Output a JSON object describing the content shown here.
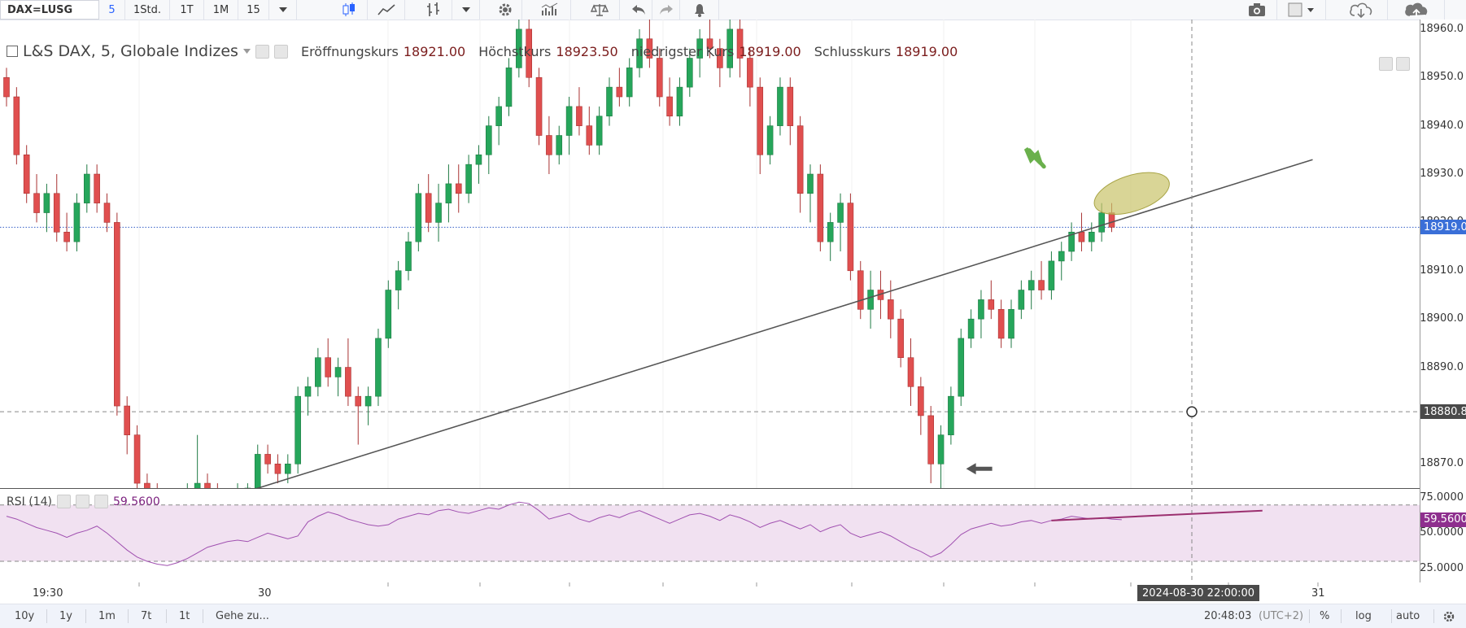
{
  "toolbar": {
    "symbol": "DAX=LUSG",
    "intervals": [
      "5",
      "1Std.",
      "1T",
      "1M",
      "15"
    ],
    "active_interval": "5"
  },
  "legend": {
    "title": "L&S DAX, 5, Globale Indizes",
    "open_label": "Eröffnungskurs",
    "open_value": "18921.00",
    "high_label": "Höchstkurs",
    "high_value": "18923.50",
    "low_label": "niedrigster Kurs",
    "low_value": "18919.00",
    "close_label": "Schlusskurs",
    "close_value": "18919.00"
  },
  "price_axis": {
    "labels": [
      "18960.0",
      "18950.0",
      "18940.0",
      "18930.0",
      "18920.0",
      "18910.0",
      "18900.0",
      "18890.0",
      "18880.0",
      "18870.0"
    ],
    "last_price_badge": "18919.0",
    "crosshair_badge": "18880.8"
  },
  "rsi": {
    "label": "RSI (14)",
    "value": "59.5600",
    "axis_labels": [
      "75.0000",
      "50.0000",
      "25.0000"
    ],
    "badge": "59.5600"
  },
  "time_axis": {
    "labels": [
      "19:30",
      "30",
      "31"
    ],
    "crosshair_label": "2024-08-30 22:00:00"
  },
  "bottombar": {
    "ranges": [
      "10y",
      "1y",
      "1m",
      "7t",
      "1t"
    ],
    "goto": "Gehe zu...",
    "clock": "20:48:03",
    "timezone": "(UTC+2)",
    "percent": "%",
    "log": "log",
    "auto": "auto"
  },
  "colors": {
    "up": "#26a65b",
    "down": "#e04f4f",
    "trendline": "#555555",
    "rsi_line": "#a050b0",
    "rsi_band": "#f1e1f1",
    "highlight": "#c9c36a",
    "arrow_green": "#6ab04c"
  },
  "chart_data": [
    {
      "type": "candlestick",
      "title": "L&S DAX, 5, Globale Indizes",
      "ylim": [
        18865,
        18962
      ],
      "last_price": 18919.0,
      "crosshair_price": 18880.8,
      "candles": [
        [
          18950,
          18952,
          18944,
          18946
        ],
        [
          18946,
          18948,
          18932,
          18934
        ],
        [
          18934,
          18936,
          18924,
          18926
        ],
        [
          18926,
          18930,
          18920,
          18922
        ],
        [
          18922,
          18928,
          18918,
          18926
        ],
        [
          18926,
          18930,
          18916,
          18918
        ],
        [
          18918,
          18922,
          18914,
          18916
        ],
        [
          18916,
          18926,
          18914,
          18924
        ],
        [
          18924,
          18932,
          18922,
          18930
        ],
        [
          18930,
          18932,
          18922,
          18924
        ],
        [
          18924,
          18926,
          18918,
          18920
        ],
        [
          18920,
          18922,
          18880,
          18882
        ],
        [
          18882,
          18884,
          18872,
          18876
        ],
        [
          18876,
          18878,
          18864,
          18866
        ],
        [
          18866,
          18868,
          18862,
          18864
        ],
        [
          18864,
          18866,
          18860,
          18862
        ],
        [
          18862,
          18864,
          18858,
          18860
        ],
        [
          18860,
          18864,
          18856,
          18862
        ],
        [
          18862,
          18866,
          18858,
          18864
        ],
        [
          18864,
          18876,
          18862,
          18866
        ],
        [
          18866,
          18868,
          18862,
          18864
        ],
        [
          18864,
          18866,
          18860,
          18862
        ],
        [
          18862,
          18864,
          18860,
          18863
        ],
        [
          18863,
          18866,
          18861,
          18864
        ],
        [
          18864,
          18866,
          18862,
          18865
        ],
        [
          18865,
          18874,
          18864,
          18872
        ],
        [
          18872,
          18874,
          18868,
          18870
        ],
        [
          18870,
          18872,
          18866,
          18868
        ],
        [
          18868,
          18872,
          18866,
          18870
        ],
        [
          18870,
          18886,
          18868,
          18884
        ],
        [
          18884,
          18888,
          18880,
          18886
        ],
        [
          18886,
          18894,
          18884,
          18892
        ],
        [
          18892,
          18896,
          18886,
          18888
        ],
        [
          18888,
          18892,
          18884,
          18890
        ],
        [
          18890,
          18896,
          18882,
          18884
        ],
        [
          18884,
          18886,
          18874,
          18882
        ],
        [
          18882,
          18886,
          18878,
          18884
        ],
        [
          18884,
          18898,
          18882,
          18896
        ],
        [
          18896,
          18908,
          18894,
          18906
        ],
        [
          18906,
          18912,
          18902,
          18910
        ],
        [
          18910,
          18918,
          18908,
          18916
        ],
        [
          18916,
          18928,
          18914,
          18926
        ],
        [
          18926,
          18930,
          18918,
          18920
        ],
        [
          18920,
          18928,
          18916,
          18924
        ],
        [
          18924,
          18932,
          18920,
          18928
        ],
        [
          18928,
          18932,
          18922,
          18926
        ],
        [
          18926,
          18934,
          18924,
          18932
        ],
        [
          18932,
          18936,
          18928,
          18934
        ],
        [
          18934,
          18942,
          18930,
          18940
        ],
        [
          18940,
          18946,
          18936,
          18944
        ],
        [
          18944,
          18954,
          18942,
          18952
        ],
        [
          18952,
          18962,
          18950,
          18960
        ],
        [
          18960,
          18962,
          18948,
          18950
        ],
        [
          18950,
          18952,
          18936,
          18938
        ],
        [
          18938,
          18942,
          18930,
          18934
        ],
        [
          18934,
          18940,
          18932,
          18938
        ],
        [
          18938,
          18946,
          18934,
          18944
        ],
        [
          18944,
          18948,
          18938,
          18940
        ],
        [
          18940,
          18944,
          18934,
          18936
        ],
        [
          18936,
          18944,
          18934,
          18942
        ],
        [
          18942,
          18950,
          18940,
          18948
        ],
        [
          18948,
          18952,
          18944,
          18946
        ],
        [
          18946,
          18954,
          18944,
          18952
        ],
        [
          18952,
          18960,
          18950,
          18958
        ],
        [
          18958,
          18962,
          18952,
          18954
        ],
        [
          18954,
          18956,
          18944,
          18946
        ],
        [
          18946,
          18950,
          18940,
          18942
        ],
        [
          18942,
          18950,
          18940,
          18948
        ],
        [
          18948,
          18956,
          18946,
          18954
        ],
        [
          18954,
          18960,
          18950,
          18958
        ],
        [
          18958,
          18962,
          18954,
          18956
        ],
        [
          18956,
          18958,
          18948,
          18952
        ],
        [
          18952,
          18962,
          18950,
          18960
        ],
        [
          18960,
          18962,
          18950,
          18954
        ],
        [
          18954,
          18956,
          18944,
          18948
        ],
        [
          18948,
          18950,
          18930,
          18934
        ],
        [
          18934,
          18942,
          18932,
          18940
        ],
        [
          18940,
          18950,
          18938,
          18948
        ],
        [
          18948,
          18950,
          18936,
          18940
        ],
        [
          18940,
          18942,
          18922,
          18926
        ],
        [
          18926,
          18932,
          18920,
          18930
        ],
        [
          18930,
          18932,
          18914,
          18916
        ],
        [
          18916,
          18922,
          18912,
          18920
        ],
        [
          18920,
          18926,
          18914,
          18924
        ],
        [
          18924,
          18926,
          18908,
          18910
        ],
        [
          18910,
          18912,
          18900,
          18902
        ],
        [
          18902,
          18910,
          18898,
          18906
        ],
        [
          18906,
          18910,
          18900,
          18904
        ],
        [
          18904,
          18908,
          18896,
          18900
        ],
        [
          18900,
          18902,
          18890,
          18892
        ],
        [
          18892,
          18896,
          18882,
          18886
        ],
        [
          18886,
          18888,
          18876,
          18880
        ],
        [
          18880,
          18882,
          18866,
          18870
        ],
        [
          18870,
          18878,
          18864,
          18876
        ],
        [
          18876,
          18886,
          18874,
          18884
        ],
        [
          18884,
          18898,
          18882,
          18896
        ],
        [
          18896,
          18902,
          18894,
          18900
        ],
        [
          18900,
          18906,
          18896,
          18904
        ],
        [
          18904,
          18908,
          18900,
          18902
        ],
        [
          18902,
          18904,
          18894,
          18896
        ],
        [
          18896,
          18904,
          18894,
          18902
        ],
        [
          18902,
          18908,
          18900,
          18906
        ],
        [
          18906,
          18910,
          18902,
          18908
        ],
        [
          18908,
          18912,
          18904,
          18906
        ],
        [
          18906,
          18914,
          18904,
          18912
        ],
        [
          18912,
          18916,
          18908,
          18914
        ],
        [
          18914,
          18920,
          18912,
          18918
        ],
        [
          18918,
          18922,
          18914,
          18916
        ],
        [
          18916,
          18920,
          18914,
          18918
        ],
        [
          18918,
          18924,
          18916,
          18922
        ],
        [
          18922,
          18924,
          18918,
          18919
        ]
      ],
      "trendline": {
        "from": [
          23.5,
          18864
        ],
        "to": [
          130,
          18933
        ]
      },
      "highlight_ellipse_center": [
        112,
        18926
      ],
      "arrow_left_at": [
        96,
        18869
      ]
    },
    {
      "type": "line",
      "title": "RSI (14)",
      "ylim": [
        15,
        82
      ],
      "bands": [
        30,
        70
      ],
      "values": [
        62,
        60,
        57,
        54,
        52,
        50,
        47,
        50,
        52,
        55,
        50,
        44,
        38,
        33,
        30,
        28,
        27,
        29,
        32,
        36,
        40,
        42,
        44,
        45,
        44,
        47,
        50,
        48,
        46,
        48,
        58,
        62,
        65,
        63,
        60,
        58,
        56,
        55,
        56,
        60,
        62,
        64,
        63,
        66,
        67,
        65,
        64,
        66,
        68,
        67,
        70,
        72,
        71,
        66,
        60,
        62,
        64,
        60,
        58,
        61,
        63,
        61,
        64,
        66,
        63,
        60,
        57,
        60,
        63,
        64,
        62,
        59,
        63,
        61,
        58,
        54,
        57,
        59,
        56,
        53,
        56,
        51,
        54,
        56,
        50,
        47,
        49,
        51,
        48,
        44,
        40,
        37,
        33,
        36,
        42,
        49,
        53,
        55,
        57,
        55,
        56,
        58,
        59,
        57,
        59,
        60,
        62,
        61,
        60,
        61,
        60,
        59.56
      ],
      "trend_segment": {
        "from": [
          104,
          59
        ],
        "to": [
          125,
          66
        ]
      }
    }
  ]
}
